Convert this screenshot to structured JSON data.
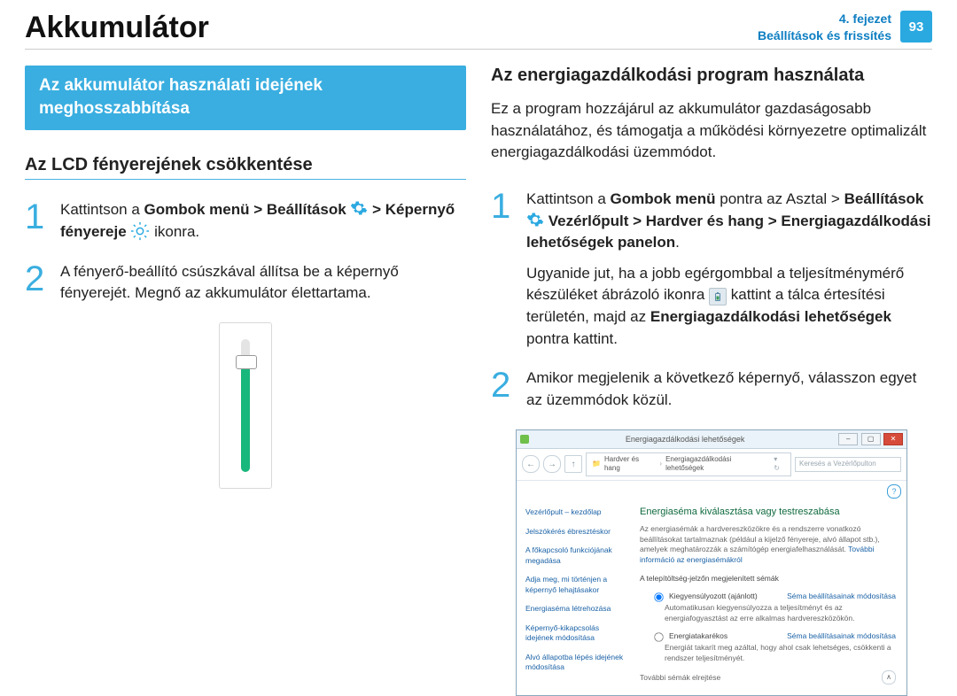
{
  "header": {
    "title": "Akkumulátor",
    "chapter_line1": "4. fejezet",
    "chapter_line2": "Beállítások és frissítés",
    "page_number": "93"
  },
  "left": {
    "ribbon": "Az akkumulátor használati idejének meghosszabbítása",
    "h2": "Az LCD fényerejének csökkentése",
    "step1": {
      "a": "Kattintson a ",
      "b": "Gombok menü > Beállítások ",
      "c": " > Képernyő fényereje ",
      "d": " ikonra."
    },
    "step2": "A fényerő-beállító csúszkával állítsa be a képernyő fényerejét. Megnő az akkumulátor élettartama."
  },
  "right": {
    "h2": "Az energiagazdálkodási program használata",
    "intro": "Ez a program hozzájárul az akkumulátor gazdaságosabb használatához, és támogatja a működési környezetre optimalizált energiagazdálkodási üzemmódot.",
    "step1": {
      "a": "Kattintson a ",
      "b": "Gombok menü",
      "c": " pontra az Asztal > ",
      "d": "Beállítások ",
      "e": " Vezérlőpult > Hardver és hang > Energiagazdálkodási lehetőségek panelon",
      "f": ".",
      "g1": "Ugyanide jut, ha a jobb egérgombbal a teljesítménymérő készüléket ábrázoló ikonra ",
      "g2": " kattint a tálca értesítési területén, majd az ",
      "g3": "Energiagazdálkodási lehetőségek",
      "g4": " pontra kattint."
    },
    "step2": "Amikor megjelenik a következő képernyő, válasszon egyet az üzemmódok közül."
  },
  "shot": {
    "window_title": "Energiagazdálkodási lehetőségek",
    "breadcrumb": {
      "a": "Hardver és hang",
      "b": "Energiagazdálkodási lehetőségek"
    },
    "search_placeholder": "Keresés a Vezérlőpulton",
    "nav": {
      "home": "Vezérlőpult – kezdőlap",
      "n1": "Jelszókérés ébresztéskor",
      "n2": "A főkapcsoló funkciójának megadása",
      "n3": "Adja meg, mi történjen a képernyő lehajtásakor",
      "n4": "Energiaséma létrehozása",
      "n5": "Képernyő-kikapcsolás idejének módosítása",
      "n6": "Alvó állapotba lépés idejének módosítása"
    },
    "main": {
      "heading": "Energiaséma kiválasztása vagy testreszabása",
      "desc": "Az energiasémák a hardvereszközökre és a rendszerre vonatkozó beállításokat tartalmaznak (például a kijelző fényereje, alvó állapot stb.), amelyek meghatározzák a számítógép energiafelhasználását.",
      "desc_link": "További információ az energiasémákról",
      "section": "A telepítöltség-jelzőn megjelenített sémák",
      "plan1_title": "Kiegyensúlyozott (ajánlott)",
      "plan1_desc": "Automatikusan kiegyensúlyozza a teljesítményt és az energiafogyasztást az erre alkalmas hardvereszközökön.",
      "plan2_title": "Energiatakarékos",
      "plan2_desc": "Energiát takarít meg azáltal, hogy ahol csak lehetséges, csökkenti a rendszer teljesítményét.",
      "change_link": "Séma beállításainak módosítása",
      "more": "További sémák elrejtése"
    }
  }
}
